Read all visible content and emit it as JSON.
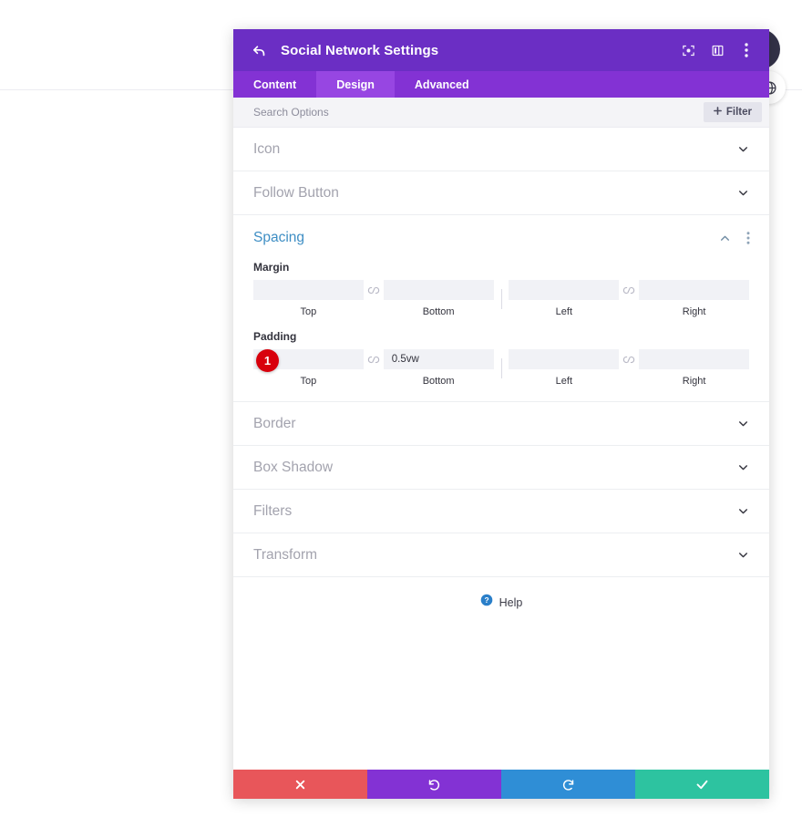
{
  "panel": {
    "title": "Social Network Settings",
    "back_icon": "back-arrow-icon",
    "header_icons": [
      "focus-target-icon",
      "layout-columns-icon",
      "more-vertical-icon"
    ],
    "tabs": [
      {
        "label": "Content",
        "active": false
      },
      {
        "label": "Design",
        "active": true
      },
      {
        "label": "Advanced",
        "active": false
      }
    ],
    "search": {
      "placeholder": "Search Options",
      "value": "",
      "filter_label": "Filter",
      "filter_icon": "plus-icon"
    },
    "sections": [
      {
        "label": "Icon",
        "state": "collapsed"
      },
      {
        "label": "Follow Button",
        "state": "collapsed"
      }
    ],
    "spacing": {
      "title": "Spacing",
      "collapse_icon": "chevron-up-icon",
      "menu_icon": "more-vertical-icon",
      "margin": {
        "label": "Margin",
        "fields": [
          {
            "caption": "Top",
            "value": "",
            "placeholder": ""
          },
          {
            "caption": "Bottom",
            "value": "",
            "placeholder": ""
          },
          {
            "caption": "Left",
            "value": "",
            "placeholder": ""
          },
          {
            "caption": "Right",
            "value": "",
            "placeholder": ""
          }
        ]
      },
      "padding": {
        "label": "Padding",
        "marker": "1",
        "fields": [
          {
            "caption": "Top",
            "value": "",
            "placeholder": ""
          },
          {
            "caption": "Bottom",
            "value": "0.5vw",
            "placeholder": ""
          },
          {
            "caption": "Left",
            "value": "",
            "placeholder": ""
          },
          {
            "caption": "Right",
            "value": "",
            "placeholder": ""
          }
        ]
      }
    },
    "sections_after": [
      {
        "label": "Border",
        "state": "collapsed"
      },
      {
        "label": "Box Shadow",
        "state": "collapsed"
      },
      {
        "label": "Filters",
        "state": "collapsed"
      },
      {
        "label": "Transform",
        "state": "collapsed"
      }
    ],
    "help": {
      "label": "Help",
      "icon": "question-circle-icon"
    },
    "footer": [
      {
        "name": "cancel",
        "icon": "close-x-icon",
        "color": "#e8565a"
      },
      {
        "name": "undo",
        "icon": "undo-icon",
        "color": "#8332d4"
      },
      {
        "name": "redo",
        "icon": "redo-icon",
        "color": "#2f8ed6"
      },
      {
        "name": "save",
        "icon": "check-icon",
        "color": "#2dc3a0"
      }
    ]
  },
  "decor": {
    "globe_icon": "globe-icon"
  },
  "colors": {
    "header_purple": "#6b2ec4",
    "tabs_purple": "#8332d4",
    "tab_active": "#9746e2",
    "section_title_blue": "#3e8ec4",
    "marker_red": "#d8000c",
    "help_blue": "#2a7fc9"
  }
}
